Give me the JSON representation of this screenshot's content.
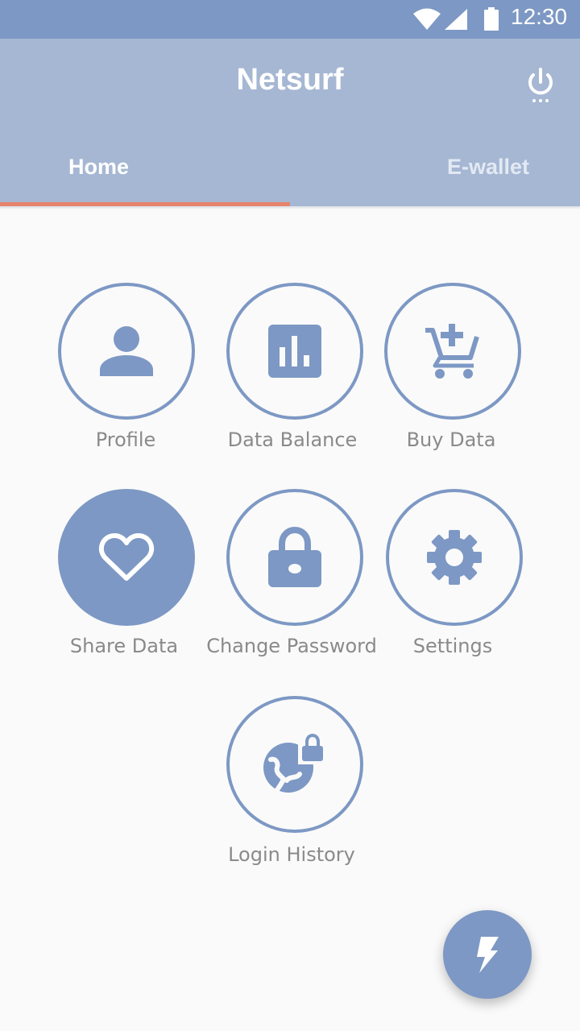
{
  "status_bar": {
    "time": "12:30",
    "icons": [
      "wifi-icon",
      "signal-icon",
      "battery-icon"
    ]
  },
  "app_bar": {
    "title": "Netsurf",
    "power_icon": "power-icon",
    "tabs": [
      {
        "label": "Home",
        "active": true
      },
      {
        "label": "E-wallet",
        "active": false
      }
    ]
  },
  "menu": {
    "items": [
      {
        "label": "Profile",
        "icon": "person-icon"
      },
      {
        "label": "Data Balance",
        "icon": "bar-chart-icon"
      },
      {
        "label": "Buy Data",
        "icon": "add-cart-icon"
      },
      {
        "label": "Share Data",
        "icon": "heart-icon",
        "selected": true
      },
      {
        "label": "Change Password",
        "icon": "lock-icon"
      },
      {
        "label": "Settings",
        "icon": "gear-icon"
      },
      {
        "label": "Login History",
        "icon": "globe-lock-icon"
      }
    ]
  },
  "fab": {
    "icon": "flash-icon"
  },
  "colors": {
    "primary": "#7d98c4",
    "app_bar": "#a6b7d3",
    "tab_indicator": "#e8836d",
    "label": "#8a8a8a"
  }
}
